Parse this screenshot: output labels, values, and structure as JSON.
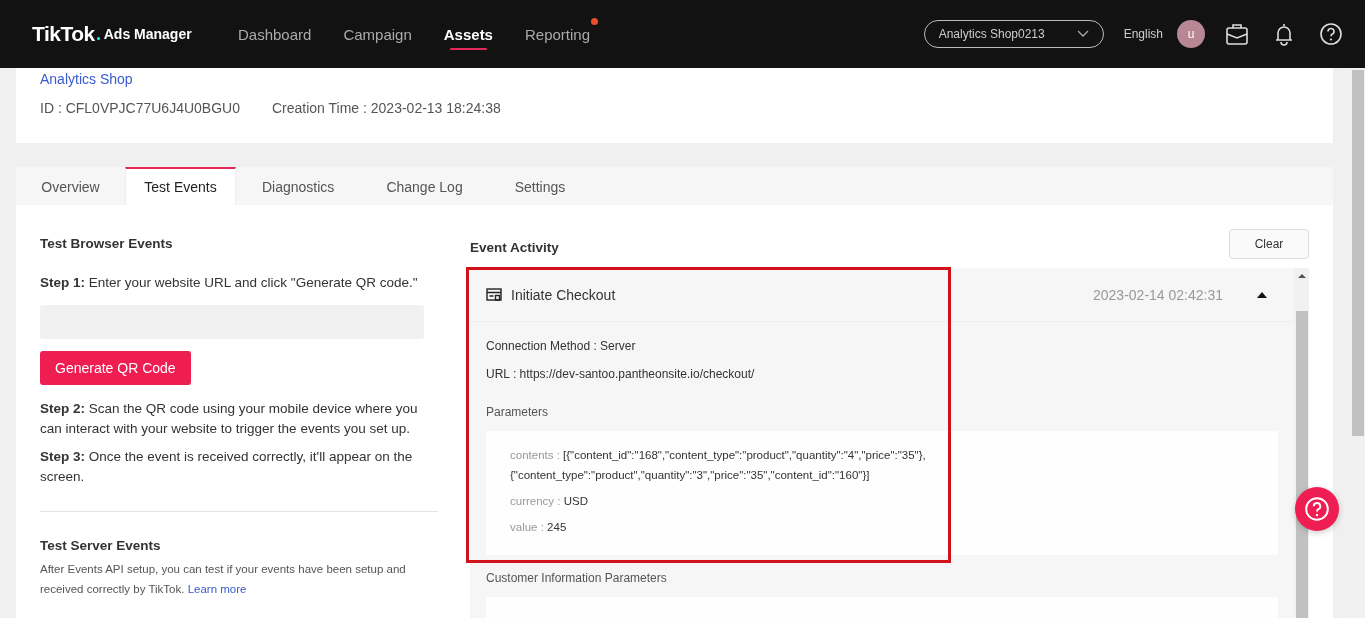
{
  "header": {
    "logo": "TikTok",
    "product": "Ads Manager",
    "nav": [
      {
        "label": "Dashboard",
        "selected": false,
        "dot": false
      },
      {
        "label": "Campaign",
        "selected": false,
        "dot": false
      },
      {
        "label": "Assets",
        "selected": true,
        "dot": false
      },
      {
        "label": "Reporting",
        "selected": false,
        "dot": true
      }
    ],
    "account": "Analytics Shop0213",
    "language": "English",
    "avatar": "u"
  },
  "pixel": {
    "name": "Analytics Shop",
    "id": "ID : CFL0VPJC77U6J4U0BGU0",
    "created": "Creation Time : 2023-02-13 18:24:38"
  },
  "tabs": [
    {
      "label": "Overview",
      "selected": false
    },
    {
      "label": "Test Events",
      "selected": true
    },
    {
      "label": "Diagnostics",
      "selected": false
    },
    {
      "label": "Change Log",
      "selected": false
    },
    {
      "label": "Settings",
      "selected": false
    }
  ],
  "browser_test": {
    "title": "Test Browser Events",
    "step_1": "**Step 1:** Enter your website URL and click \"Generate QR code.\"",
    "button": "Generate QR Code",
    "steps": [
      "**Step 2:** Scan the QR code using your mobile device where you can interact with your website to trigger the events you set up.",
      "**Step 3:** Once the event is received correctly, it'll appear on the screen."
    ]
  },
  "server_test": {
    "title": "Test Server Events",
    "text": "After Events API setup, you can test if your events have been setup and received correctly by TikTok.",
    "link": "Learn more"
  },
  "activity": {
    "title": "Event Activity",
    "clear": "Clear",
    "events": [
      {
        "name": "Initiate Checkout",
        "time": "2023-02-14 02:42:31",
        "expanded": true,
        "highlighted": true,
        "fields": [
          {
            "label": "Connection Method :",
            "value": "Server"
          },
          {
            "label": "URL :",
            "value": "https://dev-santoo.pantheonsite.io/checkout/"
          }
        ],
        "parameters_title": "Parameters",
        "parameters": [
          {
            "key": "contents :",
            "value": "[{\"content_id\":\"168\",\"content_type\":\"product\",\"quantity\":\"4\",\"price\":\"35\"},{\"content_type\":\"product\",\"quantity\":\"3\",\"price\":\"35\",\"content_id\":\"160\"}]"
          },
          {
            "key": "currency :",
            "value": "USD"
          },
          {
            "key": "value :",
            "value": "245"
          }
        ],
        "customer_title": "Customer Information Parameters"
      }
    ]
  }
}
